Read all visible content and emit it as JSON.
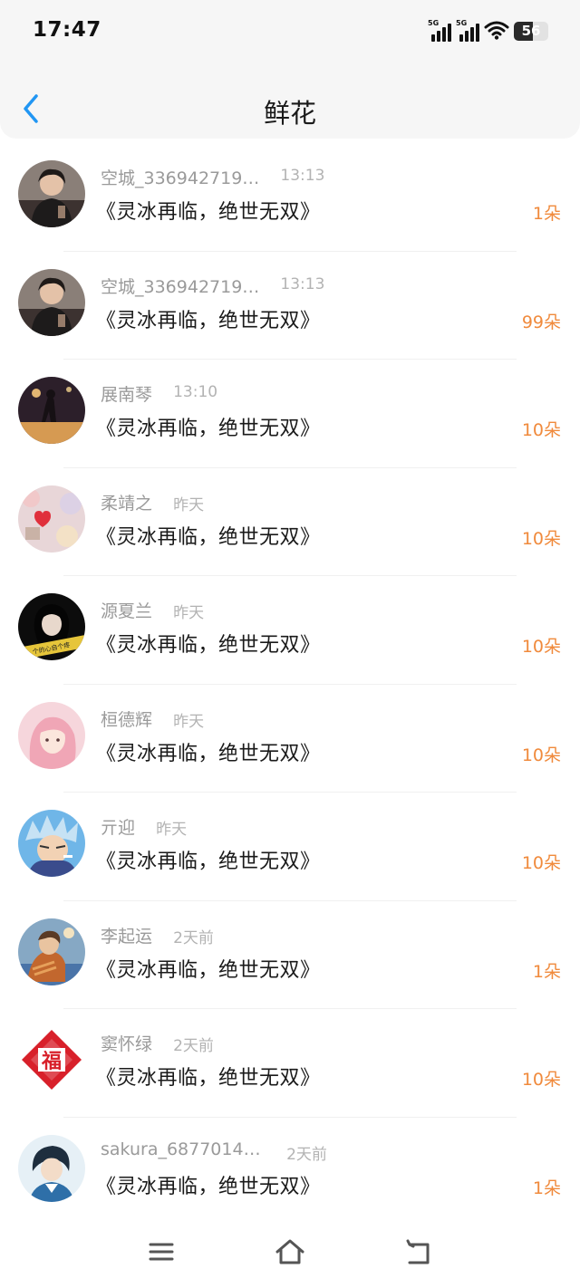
{
  "status_bar": {
    "time": "17:47",
    "signal1_label": "5G",
    "signal2_label": "5G",
    "battery_level": "56",
    "icons": [
      "signal-5g-icon",
      "signal-5g-icon",
      "wifi-icon",
      "battery-icon"
    ]
  },
  "header": {
    "title": "鲜花",
    "back_icon": "chevron-left-icon",
    "accent_color": "#2196F3"
  },
  "gifts": [
    {
      "user": "空城_336942719…",
      "time": "13:13",
      "book": "《灵冰再临，绝世无双》",
      "amount": "1朵"
    },
    {
      "user": "空城_336942719…",
      "time": "13:13",
      "book": "《灵冰再临，绝世无双》",
      "amount": "99朵"
    },
    {
      "user": "展南琴",
      "time": "13:10",
      "book": "《灵冰再临，绝世无双》",
      "amount": "10朵"
    },
    {
      "user": "柔靖之",
      "time": "昨天",
      "book": "《灵冰再临，绝世无双》",
      "amount": "10朵"
    },
    {
      "user": "源夏兰",
      "time": "昨天",
      "book": "《灵冰再临，绝世无双》",
      "amount": "10朵"
    },
    {
      "user": "桓德辉",
      "time": "昨天",
      "book": "《灵冰再临，绝世无双》",
      "amount": "10朵"
    },
    {
      "user": "亓迎",
      "time": "昨天",
      "book": "《灵冰再临，绝世无双》",
      "amount": "10朵"
    },
    {
      "user": "李起运",
      "time": "2天前",
      "book": "《灵冰再临，绝世无双》",
      "amount": "1朵"
    },
    {
      "user": "窦怀绿",
      "time": "2天前",
      "book": "《灵冰再临，绝世无双》",
      "amount": "10朵"
    },
    {
      "user": "sakura_68770145…",
      "time": "2天前",
      "book": "《灵冰再临，绝世无双》",
      "amount": "1朵"
    }
  ],
  "avatar_text": {
    "a4": "个的心自个疼",
    "a8": "福"
  },
  "colors": {
    "amount": "#f08a3c",
    "username": "#9a9a9a",
    "timestamp": "#b3b3b3"
  },
  "bottom_nav": {
    "icons": [
      "menu-icon",
      "home-icon",
      "back-icon"
    ]
  }
}
